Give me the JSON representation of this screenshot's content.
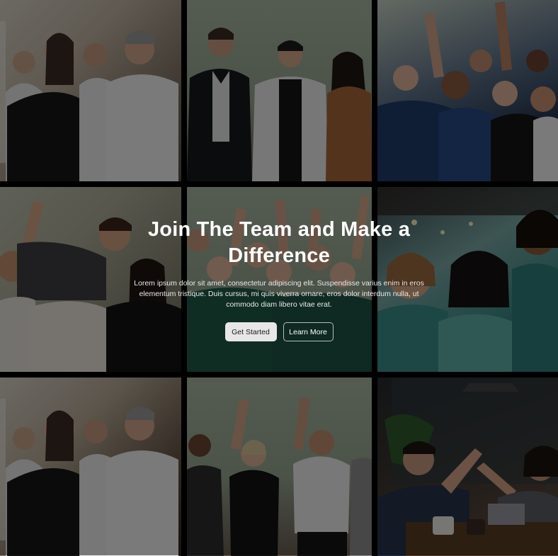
{
  "hero": {
    "headline": "Join The Team and Make a Difference",
    "subtext": "Lorem ipsum dolor sit amet, consectetur adipiscing elit. Suspendisse varius enim in eros elementum tristique. Duis cursus, mi quis viverra ornare, eros dolor interdum nulla, ut commodo diam libero vitae erat.",
    "primary_button": "Get Started",
    "secondary_button": "Learn More",
    "overlay_color": "#000000"
  },
  "gallery": {
    "images": [
      {
        "name": "team-office-photo"
      },
      {
        "name": "team-conversation-photo"
      },
      {
        "name": "team-celebrating-photo"
      },
      {
        "name": "team-cheering-photo"
      },
      {
        "name": "team-hands-raised-photo"
      },
      {
        "name": "team-laughing-photo"
      },
      {
        "name": "team-office-photo-repeat"
      },
      {
        "name": "team-dancing-photo"
      },
      {
        "name": "team-high-five-photo"
      }
    ]
  }
}
